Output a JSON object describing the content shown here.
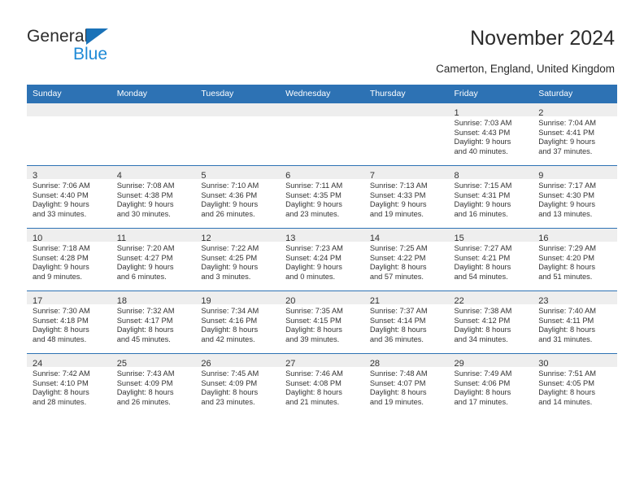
{
  "brand": {
    "word_one": "General",
    "word_two": "Blue",
    "triangle_icon": "blue-triangle-icon"
  },
  "header": {
    "title": "November 2024",
    "subtitle": "Camerton, England, United Kingdom"
  },
  "colors": {
    "header_blue": "#2d72b4",
    "brand_blue": "#1f8ad6",
    "daynum_band": "#eeeeee",
    "text": "#333333"
  },
  "weekday_headers": [
    "Sunday",
    "Monday",
    "Tuesday",
    "Wednesday",
    "Thursday",
    "Friday",
    "Saturday"
  ],
  "weeks": [
    [
      {
        "day": "",
        "lines": []
      },
      {
        "day": "",
        "lines": []
      },
      {
        "day": "",
        "lines": []
      },
      {
        "day": "",
        "lines": []
      },
      {
        "day": "",
        "lines": []
      },
      {
        "day": "1",
        "lines": [
          "Sunrise: 7:03 AM",
          "Sunset: 4:43 PM",
          "Daylight: 9 hours",
          "and 40 minutes."
        ]
      },
      {
        "day": "2",
        "lines": [
          "Sunrise: 7:04 AM",
          "Sunset: 4:41 PM",
          "Daylight: 9 hours",
          "and 37 minutes."
        ]
      }
    ],
    [
      {
        "day": "3",
        "lines": [
          "Sunrise: 7:06 AM",
          "Sunset: 4:40 PM",
          "Daylight: 9 hours",
          "and 33 minutes."
        ]
      },
      {
        "day": "4",
        "lines": [
          "Sunrise: 7:08 AM",
          "Sunset: 4:38 PM",
          "Daylight: 9 hours",
          "and 30 minutes."
        ]
      },
      {
        "day": "5",
        "lines": [
          "Sunrise: 7:10 AM",
          "Sunset: 4:36 PM",
          "Daylight: 9 hours",
          "and 26 minutes."
        ]
      },
      {
        "day": "6",
        "lines": [
          "Sunrise: 7:11 AM",
          "Sunset: 4:35 PM",
          "Daylight: 9 hours",
          "and 23 minutes."
        ]
      },
      {
        "day": "7",
        "lines": [
          "Sunrise: 7:13 AM",
          "Sunset: 4:33 PM",
          "Daylight: 9 hours",
          "and 19 minutes."
        ]
      },
      {
        "day": "8",
        "lines": [
          "Sunrise: 7:15 AM",
          "Sunset: 4:31 PM",
          "Daylight: 9 hours",
          "and 16 minutes."
        ]
      },
      {
        "day": "9",
        "lines": [
          "Sunrise: 7:17 AM",
          "Sunset: 4:30 PM",
          "Daylight: 9 hours",
          "and 13 minutes."
        ]
      }
    ],
    [
      {
        "day": "10",
        "lines": [
          "Sunrise: 7:18 AM",
          "Sunset: 4:28 PM",
          "Daylight: 9 hours",
          "and 9 minutes."
        ]
      },
      {
        "day": "11",
        "lines": [
          "Sunrise: 7:20 AM",
          "Sunset: 4:27 PM",
          "Daylight: 9 hours",
          "and 6 minutes."
        ]
      },
      {
        "day": "12",
        "lines": [
          "Sunrise: 7:22 AM",
          "Sunset: 4:25 PM",
          "Daylight: 9 hours",
          "and 3 minutes."
        ]
      },
      {
        "day": "13",
        "lines": [
          "Sunrise: 7:23 AM",
          "Sunset: 4:24 PM",
          "Daylight: 9 hours",
          "and 0 minutes."
        ]
      },
      {
        "day": "14",
        "lines": [
          "Sunrise: 7:25 AM",
          "Sunset: 4:22 PM",
          "Daylight: 8 hours",
          "and 57 minutes."
        ]
      },
      {
        "day": "15",
        "lines": [
          "Sunrise: 7:27 AM",
          "Sunset: 4:21 PM",
          "Daylight: 8 hours",
          "and 54 minutes."
        ]
      },
      {
        "day": "16",
        "lines": [
          "Sunrise: 7:29 AM",
          "Sunset: 4:20 PM",
          "Daylight: 8 hours",
          "and 51 minutes."
        ]
      }
    ],
    [
      {
        "day": "17",
        "lines": [
          "Sunrise: 7:30 AM",
          "Sunset: 4:18 PM",
          "Daylight: 8 hours",
          "and 48 minutes."
        ]
      },
      {
        "day": "18",
        "lines": [
          "Sunrise: 7:32 AM",
          "Sunset: 4:17 PM",
          "Daylight: 8 hours",
          "and 45 minutes."
        ]
      },
      {
        "day": "19",
        "lines": [
          "Sunrise: 7:34 AM",
          "Sunset: 4:16 PM",
          "Daylight: 8 hours",
          "and 42 minutes."
        ]
      },
      {
        "day": "20",
        "lines": [
          "Sunrise: 7:35 AM",
          "Sunset: 4:15 PM",
          "Daylight: 8 hours",
          "and 39 minutes."
        ]
      },
      {
        "day": "21",
        "lines": [
          "Sunrise: 7:37 AM",
          "Sunset: 4:14 PM",
          "Daylight: 8 hours",
          "and 36 minutes."
        ]
      },
      {
        "day": "22",
        "lines": [
          "Sunrise: 7:38 AM",
          "Sunset: 4:12 PM",
          "Daylight: 8 hours",
          "and 34 minutes."
        ]
      },
      {
        "day": "23",
        "lines": [
          "Sunrise: 7:40 AM",
          "Sunset: 4:11 PM",
          "Daylight: 8 hours",
          "and 31 minutes."
        ]
      }
    ],
    [
      {
        "day": "24",
        "lines": [
          "Sunrise: 7:42 AM",
          "Sunset: 4:10 PM",
          "Daylight: 8 hours",
          "and 28 minutes."
        ]
      },
      {
        "day": "25",
        "lines": [
          "Sunrise: 7:43 AM",
          "Sunset: 4:09 PM",
          "Daylight: 8 hours",
          "and 26 minutes."
        ]
      },
      {
        "day": "26",
        "lines": [
          "Sunrise: 7:45 AM",
          "Sunset: 4:09 PM",
          "Daylight: 8 hours",
          "and 23 minutes."
        ]
      },
      {
        "day": "27",
        "lines": [
          "Sunrise: 7:46 AM",
          "Sunset: 4:08 PM",
          "Daylight: 8 hours",
          "and 21 minutes."
        ]
      },
      {
        "day": "28",
        "lines": [
          "Sunrise: 7:48 AM",
          "Sunset: 4:07 PM",
          "Daylight: 8 hours",
          "and 19 minutes."
        ]
      },
      {
        "day": "29",
        "lines": [
          "Sunrise: 7:49 AM",
          "Sunset: 4:06 PM",
          "Daylight: 8 hours",
          "and 17 minutes."
        ]
      },
      {
        "day": "30",
        "lines": [
          "Sunrise: 7:51 AM",
          "Sunset: 4:05 PM",
          "Daylight: 8 hours",
          "and 14 minutes."
        ]
      }
    ]
  ]
}
